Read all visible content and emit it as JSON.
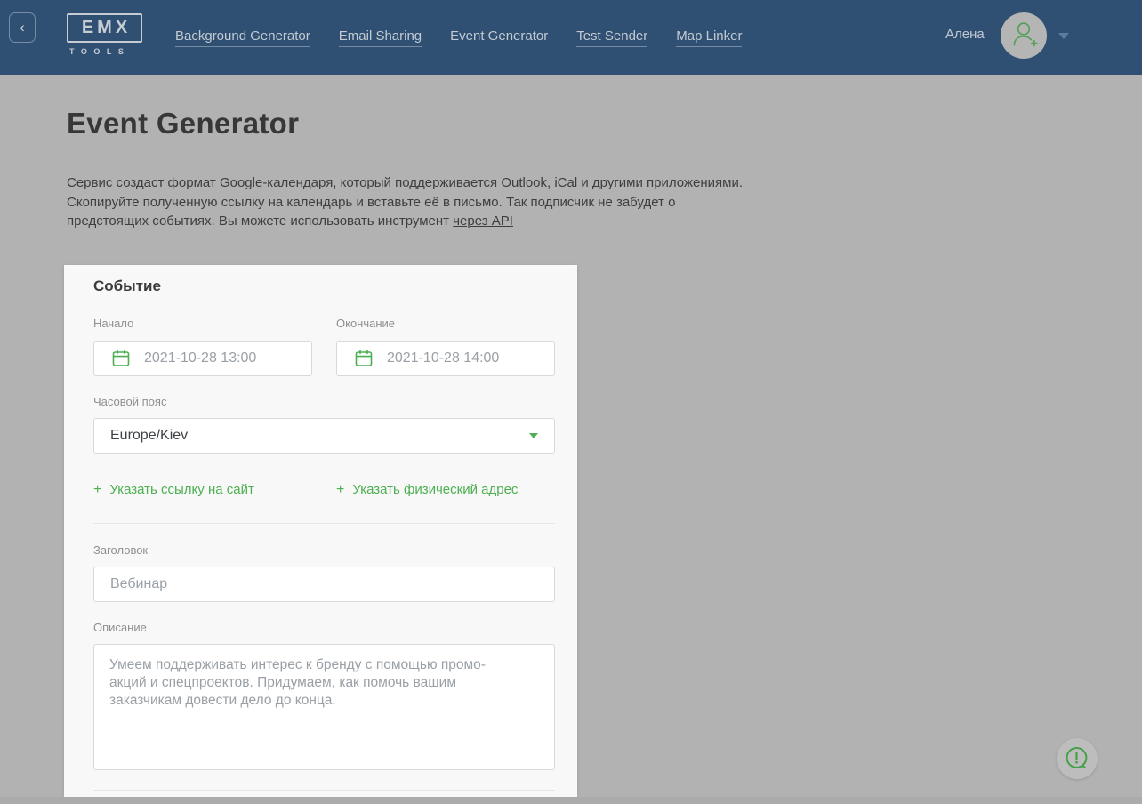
{
  "colors": {
    "header_bg": "#2f5073",
    "accent_green": "#4caf50",
    "page_overlay_gray": "#b2b2b2"
  },
  "header": {
    "back_button": "‹",
    "logo": {
      "title": "EMX",
      "subtitle": "TOOLS"
    },
    "nav": [
      {
        "label": "Background Generator",
        "active": false
      },
      {
        "label": "Email Sharing",
        "active": false
      },
      {
        "label": "Event Generator",
        "active": true
      },
      {
        "label": "Test Sender",
        "active": false
      },
      {
        "label": "Map Linker",
        "active": false
      }
    ],
    "user": {
      "name": "Алена"
    }
  },
  "page": {
    "title": "Event Generator",
    "description": {
      "line1": "Сервис создаст формат Google-календаря, который поддерживается Outlook, iCal и другими приложениями.",
      "line2": "Скопируйте полученную ссылку на календарь и вставьте её в письмо. Так подписчик не забудет о",
      "line3_prefix": "предстоящих событиях. Вы можете использовать инструмент ",
      "api_link": "через API"
    }
  },
  "form": {
    "section_title": "Событие",
    "start": {
      "label": "Начало",
      "value": "2021-10-28 13:00"
    },
    "end": {
      "label": "Окончание",
      "value": "2021-10-28 14:00"
    },
    "timezone": {
      "label": "Часовой пояс",
      "value": "Europe/Kiev"
    },
    "links": {
      "plus": "+",
      "site": "Указать ссылку на сайт",
      "address": "Указать физический адрес"
    },
    "title_field": {
      "label": "Заголовок",
      "value": "Вебинар"
    },
    "description_field": {
      "label": "Описание",
      "value": "Умеем поддерживать интерес к бренду с помощью промо-\nакций и спецпроектов. Придумаем, как помочь вашим\nзаказчикам довести дело до конца."
    }
  }
}
